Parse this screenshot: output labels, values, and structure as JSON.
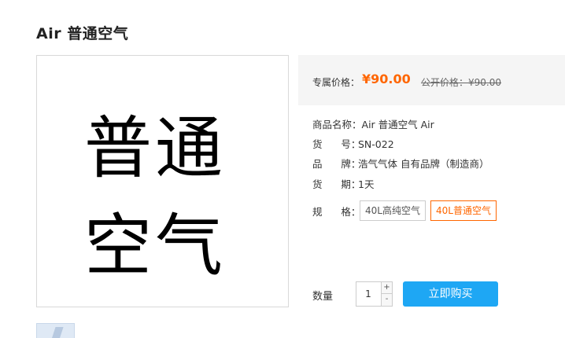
{
  "product": {
    "title": "Air 普通空气",
    "image_glyphs": [
      "普通",
      "空气"
    ]
  },
  "price": {
    "exclusive_label": "专属价格：",
    "exclusive_value": "¥90.00",
    "public_label": "公开价格：",
    "public_value": "¥90.00"
  },
  "info": {
    "name_label": "商品名称：",
    "name_value": "Air 普通空气  Air",
    "sku_label": "货      号：",
    "sku_value": "SN-022",
    "brand_label": "品      牌：",
    "brand_value": "浩气气体 自有品牌（制造商）",
    "lead_label": "货      期：",
    "lead_value": "1天"
  },
  "spec": {
    "label": "规      格：",
    "options": [
      "40L高纯空气",
      "40L普通空气"
    ],
    "selected": "40L普通空气"
  },
  "quantity": {
    "label": "数量",
    "value": "1",
    "plus": "+",
    "minus": "-"
  },
  "actions": {
    "buy_label": "立即购买"
  },
  "colors": {
    "accent": "#ff6600",
    "buy_button": "#1ea7f4",
    "price_panel_bg": "#f5f5f5"
  }
}
